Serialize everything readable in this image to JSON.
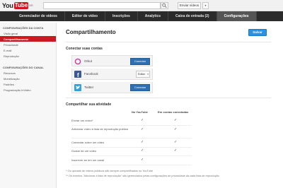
{
  "header": {
    "logo_you": "You",
    "logo_tube": "Tube",
    "logo_region": "BR",
    "upload_label": "Enviar vídeos",
    "caret": "▾"
  },
  "nav": {
    "tabs": [
      {
        "label": "Gerenciador de vídeos",
        "active": false
      },
      {
        "label": "Editor de vídeo",
        "active": false
      },
      {
        "label": "Inscrições",
        "active": false
      },
      {
        "label": "Analytics",
        "active": false
      },
      {
        "label": "Caixa de entrada (2)",
        "active": false
      },
      {
        "label": "Configurações",
        "active": true
      }
    ]
  },
  "sidebar": {
    "sections": [
      {
        "heading": "CONFIGURAÇÕES DA CONTA",
        "items": [
          "Visão geral",
          "Compartilhamento",
          "Privacidade",
          "E-mail",
          "Reprodução"
        ],
        "active": "Compartilhamento"
      },
      {
        "heading": "CONFIGURAÇÕES DO CANAL",
        "items": [
          "Recursos",
          "Monetização",
          "Padrões",
          "Programação InVideo"
        ]
      }
    ]
  },
  "main": {
    "title": "Compartilhamento",
    "save_label": "Salvar",
    "connect_heading": "Conectar suas contas",
    "accounts": [
      {
        "name": "Orkut",
        "action": "Conectar",
        "type": "button",
        "icon": "orkut-icon"
      },
      {
        "name": "Facebook",
        "action": "Editar",
        "type": "dropdown",
        "icon": "facebook-icon"
      },
      {
        "name": "Twitter",
        "action": "Conectar",
        "type": "button",
        "icon": "twitter-icon"
      }
    ],
    "share_heading": "Compartilhar sua atividade",
    "columns": [
      "No YouTube",
      "Em contas conectadas"
    ],
    "rows": [
      {
        "label": "Enviar um vídeo*",
        "yt": true,
        "connected": true
      },
      {
        "label": "Adicionar vídeo à lista de reprodução pública",
        "yt": true,
        "connected": true
      },
      {
        "label": "Comentar sobre um vídeo",
        "yt": true,
        "connected": true
      },
      {
        "label": "Gostar de um vídeo",
        "yt": true,
        "connected": true
      },
      {
        "label": "Inscrever-se em um canal",
        "yt": true,
        "connected": false
      }
    ],
    "check_symbol": "✓",
    "footnotes": [
      "* Os uploads de vídeos públicos são sempre compartilhados no YouTube",
      "** Os eventos \"Adicionar à lista de reprodução\" são gerenciados pelas configurações de privacidade da cada lista de reprodução"
    ]
  },
  "colors": {
    "accent_red": "#cc181e",
    "save_blue": "#2793e6",
    "connect_blue": "#2d6fb3",
    "nav_dark": "#2b2b2b"
  }
}
